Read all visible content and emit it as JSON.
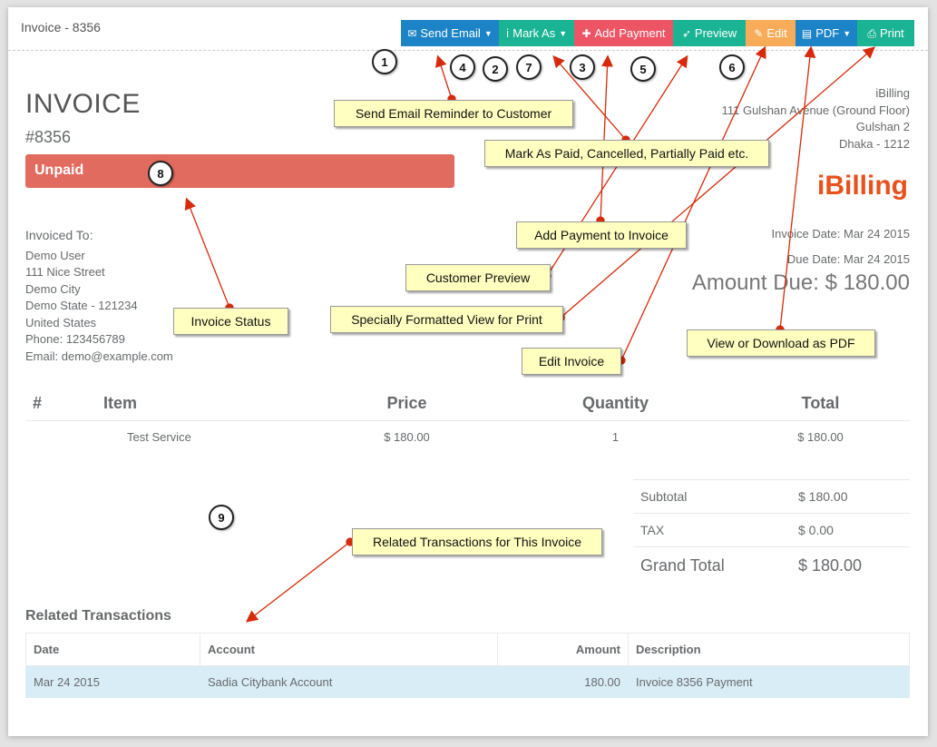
{
  "header": {
    "title": "Invoice - 8356"
  },
  "toolbar": {
    "send_email": "Send Email",
    "mark_as": "Mark As",
    "add_payment": "Add Payment",
    "preview": "Preview",
    "edit": "Edit",
    "pdf": "PDF",
    "print": "Print"
  },
  "invoice": {
    "title": "INVOICE",
    "number": "#8356",
    "status": "Unpaid"
  },
  "company": {
    "name": "iBilling",
    "address1": "111 Gulshan Avenue (Ground Floor)",
    "address2": "Gulshan 2",
    "address3": "Dhaka - 1212",
    "brand": "iBilling"
  },
  "dates": {
    "invoice_date": "Invoice Date: Mar 24 2015",
    "due_date": "Due Date: Mar 24 2015"
  },
  "amount_due": "Amount Due: $ 180.00",
  "client": {
    "label": "Invoiced To:",
    "name": "Demo User",
    "street": "111 Nice Street",
    "city": "Demo City",
    "state": "Demo State - 121234",
    "country": "United States",
    "phone": "Phone: 123456789",
    "email": "Email: demo@example.com"
  },
  "items": {
    "headers": {
      "num": "#",
      "item": "Item",
      "price": "Price",
      "qty": "Quantity",
      "total": "Total"
    },
    "rows": [
      {
        "num": "",
        "item": "Test Service",
        "price": "$ 180.00",
        "qty": "1",
        "total": "$ 180.00"
      }
    ]
  },
  "totals": {
    "subtotal_label": "Subtotal",
    "subtotal": "$ 180.00",
    "tax_label": "TAX",
    "tax": "$ 0.00",
    "grand_label": "Grand Total",
    "grand": "$ 180.00"
  },
  "related": {
    "title": "Related Transactions",
    "headers": {
      "date": "Date",
      "account": "Account",
      "amount": "Amount",
      "description": "Description"
    },
    "rows": [
      {
        "date": "Mar 24 2015",
        "account": "Sadia Citybank Account",
        "amount": "180.00",
        "description": "Invoice 8356 Payment"
      }
    ]
  },
  "annotations": {
    "callouts": {
      "send_email": "Send Email Reminder to Customer",
      "mark_as": "Mark As Paid, Cancelled, Partially Paid etc.",
      "add_payment": "Add Payment to Invoice",
      "preview": "Customer Preview",
      "print": "Specially Formatted View for Print",
      "edit": "Edit Invoice",
      "pdf": "View or Download as PDF",
      "status": "Invoice Status",
      "related": "Related Transactions for This Invoice"
    },
    "numbers": {
      "n1": "1",
      "n2": "2",
      "n3": "3",
      "n4": "4",
      "n5": "5",
      "n6": "6",
      "n7": "7",
      "n8": "8",
      "n9": "9"
    }
  },
  "colors": {
    "blue": "#1c84c6",
    "green": "#1ab394",
    "red": "#ed5565",
    "orange": "#f8ac59",
    "status": "#e26b5f",
    "brand": "#e8501c",
    "highlight_row": "#d9edf7",
    "callout_bg": "#ffffc0",
    "arrow": "#d62a0a"
  }
}
